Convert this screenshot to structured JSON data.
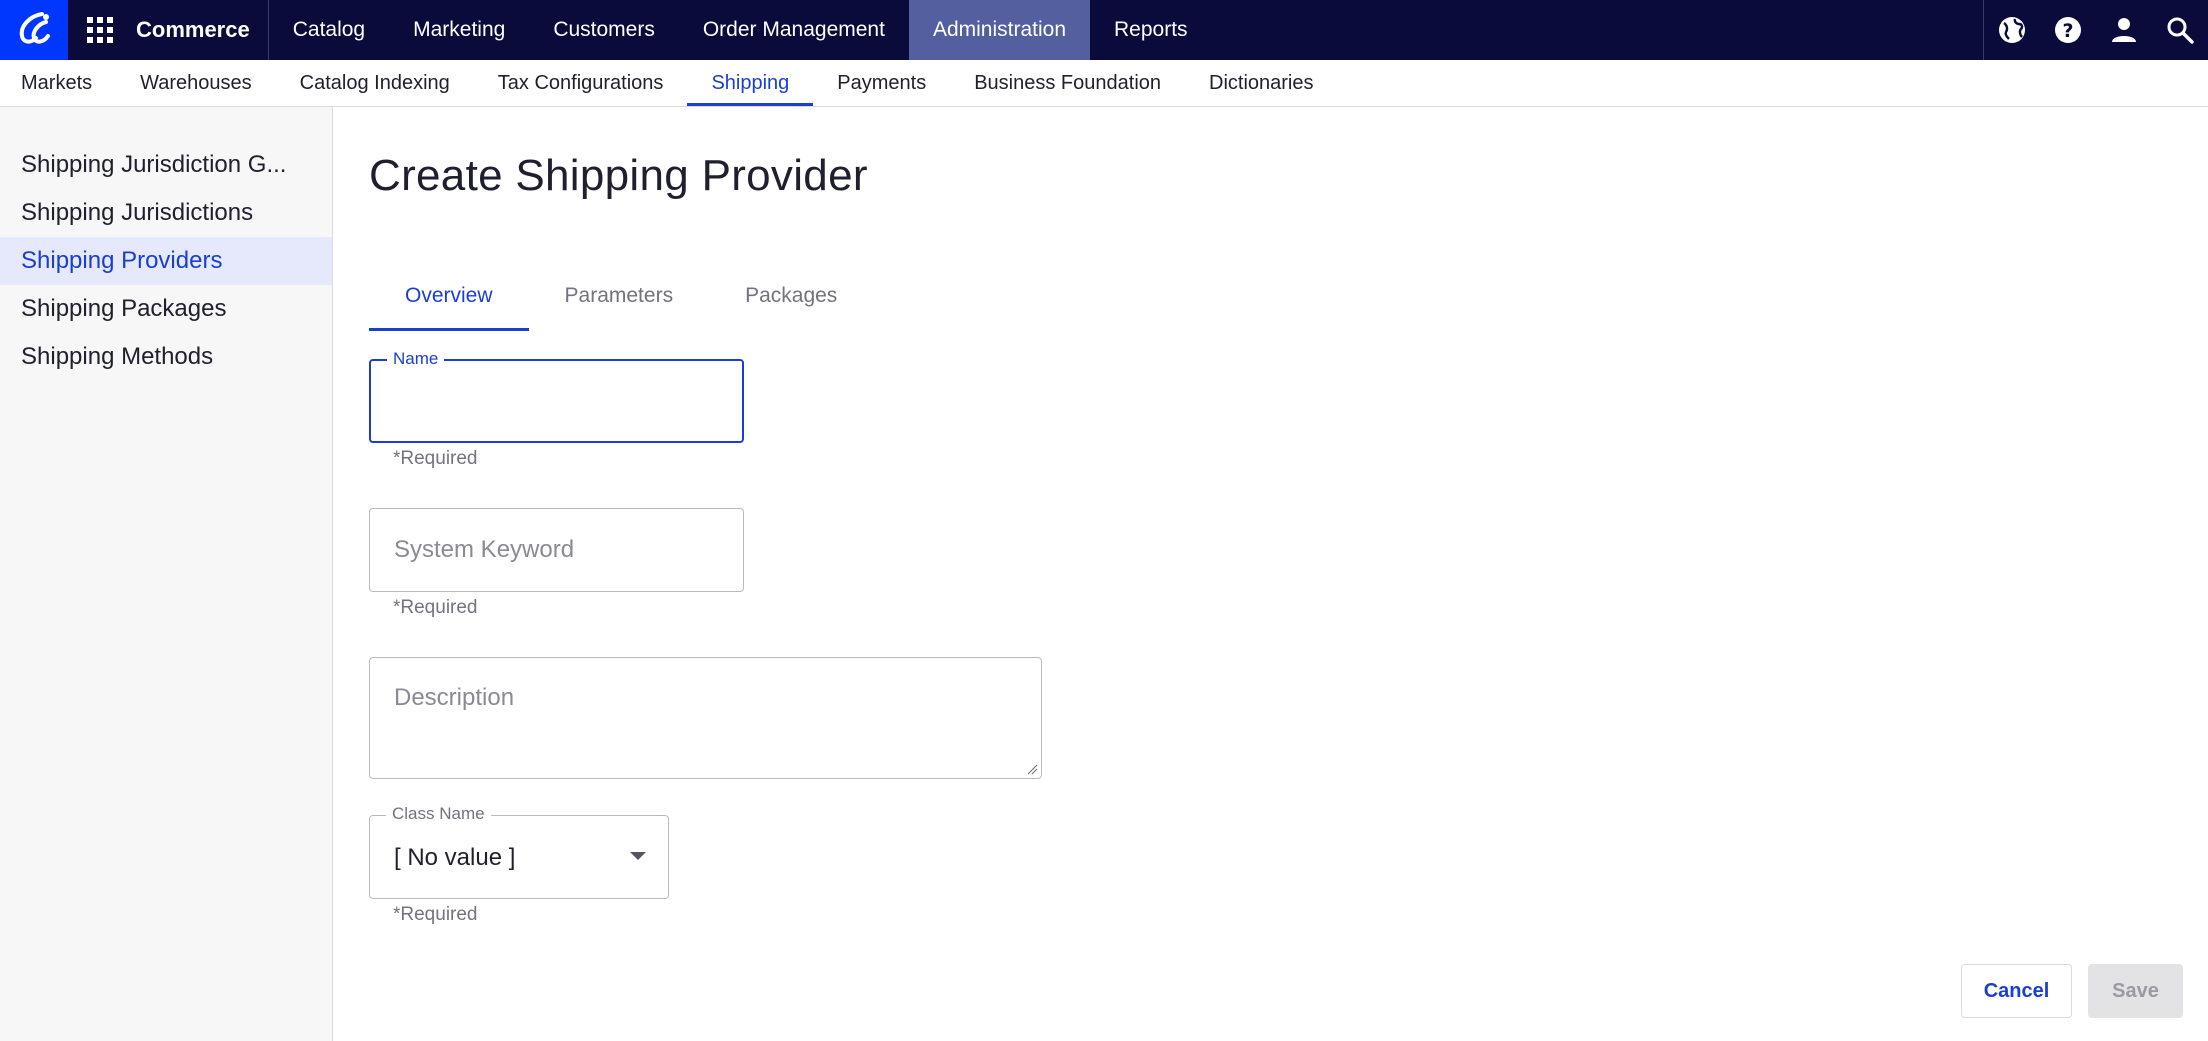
{
  "topnav": {
    "brand": "Commerce",
    "items": [
      "Catalog",
      "Marketing",
      "Customers",
      "Order Management",
      "Administration",
      "Reports"
    ],
    "active": "Administration"
  },
  "subnav": {
    "items": [
      "Markets",
      "Warehouses",
      "Catalog Indexing",
      "Tax Configurations",
      "Shipping",
      "Payments",
      "Business Foundation",
      "Dictionaries"
    ],
    "active": "Shipping"
  },
  "sidebar": {
    "items": [
      "Shipping Jurisdiction G...",
      "Shipping Jurisdictions",
      "Shipping Providers",
      "Shipping Packages",
      "Shipping Methods"
    ],
    "active": "Shipping Providers"
  },
  "page": {
    "title": "Create Shipping Provider",
    "tabs": [
      "Overview",
      "Parameters",
      "Packages"
    ],
    "active_tab": "Overview"
  },
  "form": {
    "name": {
      "label": "Name",
      "value": "",
      "helper": "*Required"
    },
    "system_keyword": {
      "placeholder": "System Keyword",
      "value": "",
      "helper": "*Required"
    },
    "description": {
      "placeholder": "Description",
      "value": ""
    },
    "class_name": {
      "label": "Class Name",
      "value": "[ No value ]",
      "helper": "*Required"
    }
  },
  "actions": {
    "cancel": "Cancel",
    "save": "Save"
  },
  "colors": {
    "topnav_bg": "#0b0b3b",
    "accent": "#1a3fd0",
    "logo_bg": "#0037ff",
    "active_nav_bg": "#545fa0"
  }
}
